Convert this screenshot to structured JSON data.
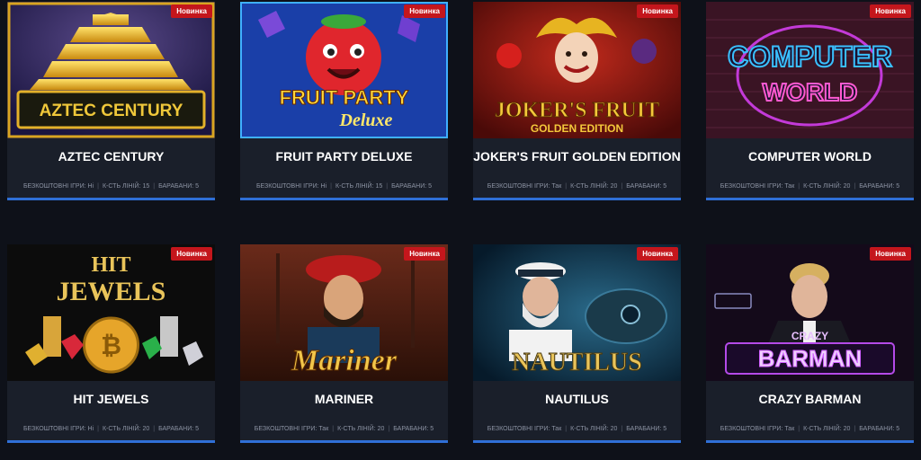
{
  "cards": [
    {
      "title": "AZTEC CENTURY",
      "art": "AZTEC CENTURY",
      "badge": "Новинка",
      "free": "БЕЗКОШТОВНІ ІГРИ: Ні",
      "lines": "К-СТЬ ЛІНІЙ: 15",
      "reels": "БАРАБАНИ: 5"
    },
    {
      "title": "FRUIT PARTY DELUXE",
      "art": "FRUIT PARTY",
      "art2": "Deluxe",
      "badge": "Новинка",
      "free": "БЕЗКОШТОВНІ ІГРИ: Ні",
      "lines": "К-СТЬ ЛІНІЙ: 15",
      "reels": "БАРАБАНИ: 5"
    },
    {
      "title": "JOKER'S FRUIT GOLDEN EDITION",
      "art": "JOKER'S FRUIT",
      "art2": "GOLDEN EDITION",
      "badge": "Новинка",
      "free": "БЕЗКОШТОВНІ ІГРИ: Так",
      "lines": "К-СТЬ ЛІНІЙ: 20",
      "reels": "БАРАБАНИ: 5"
    },
    {
      "title": "COMPUTER WORLD",
      "art": "COMPUTER",
      "art2": "WORLD",
      "badge": "Новинка",
      "free": "БЕЗКОШТОВНІ ІГРИ: Так",
      "lines": "К-СТЬ ЛІНІЙ: 20",
      "reels": "БАРАБАНИ: 5"
    },
    {
      "title": "HIT JEWELS",
      "art": "HIT",
      "art2": "JEWELS",
      "badge": "Новинка",
      "free": "БЕЗКОШТОВНІ ІГРИ: Ні",
      "lines": "К-СТЬ ЛІНІЙ: 20",
      "reels": "БАРАБАНИ: 5"
    },
    {
      "title": "MARINER",
      "art": "Mariner",
      "badge": "Новинка",
      "free": "БЕЗКОШТОВНІ ІГРИ: Так",
      "lines": "К-СТЬ ЛІНІЙ: 20",
      "reels": "БАРАБАНИ: 5"
    },
    {
      "title": "NAUTILUS",
      "art": "NAUTILUS",
      "badge": "Новинка",
      "free": "БЕЗКОШТОВНІ ІГРИ: Так",
      "lines": "К-СТЬ ЛІНІЙ: 20",
      "reels": "БАРАБАНИ: 5"
    },
    {
      "title": "CRAZY BARMAN",
      "art": "BARMAN",
      "art2": "CRAZY",
      "badge": "Новинка",
      "free": "БЕЗКОШТОВНІ ІГРИ: Так",
      "lines": "К-СТЬ ЛІНІЙ: 20",
      "reels": "БАРАБАНИ: 5"
    }
  ]
}
